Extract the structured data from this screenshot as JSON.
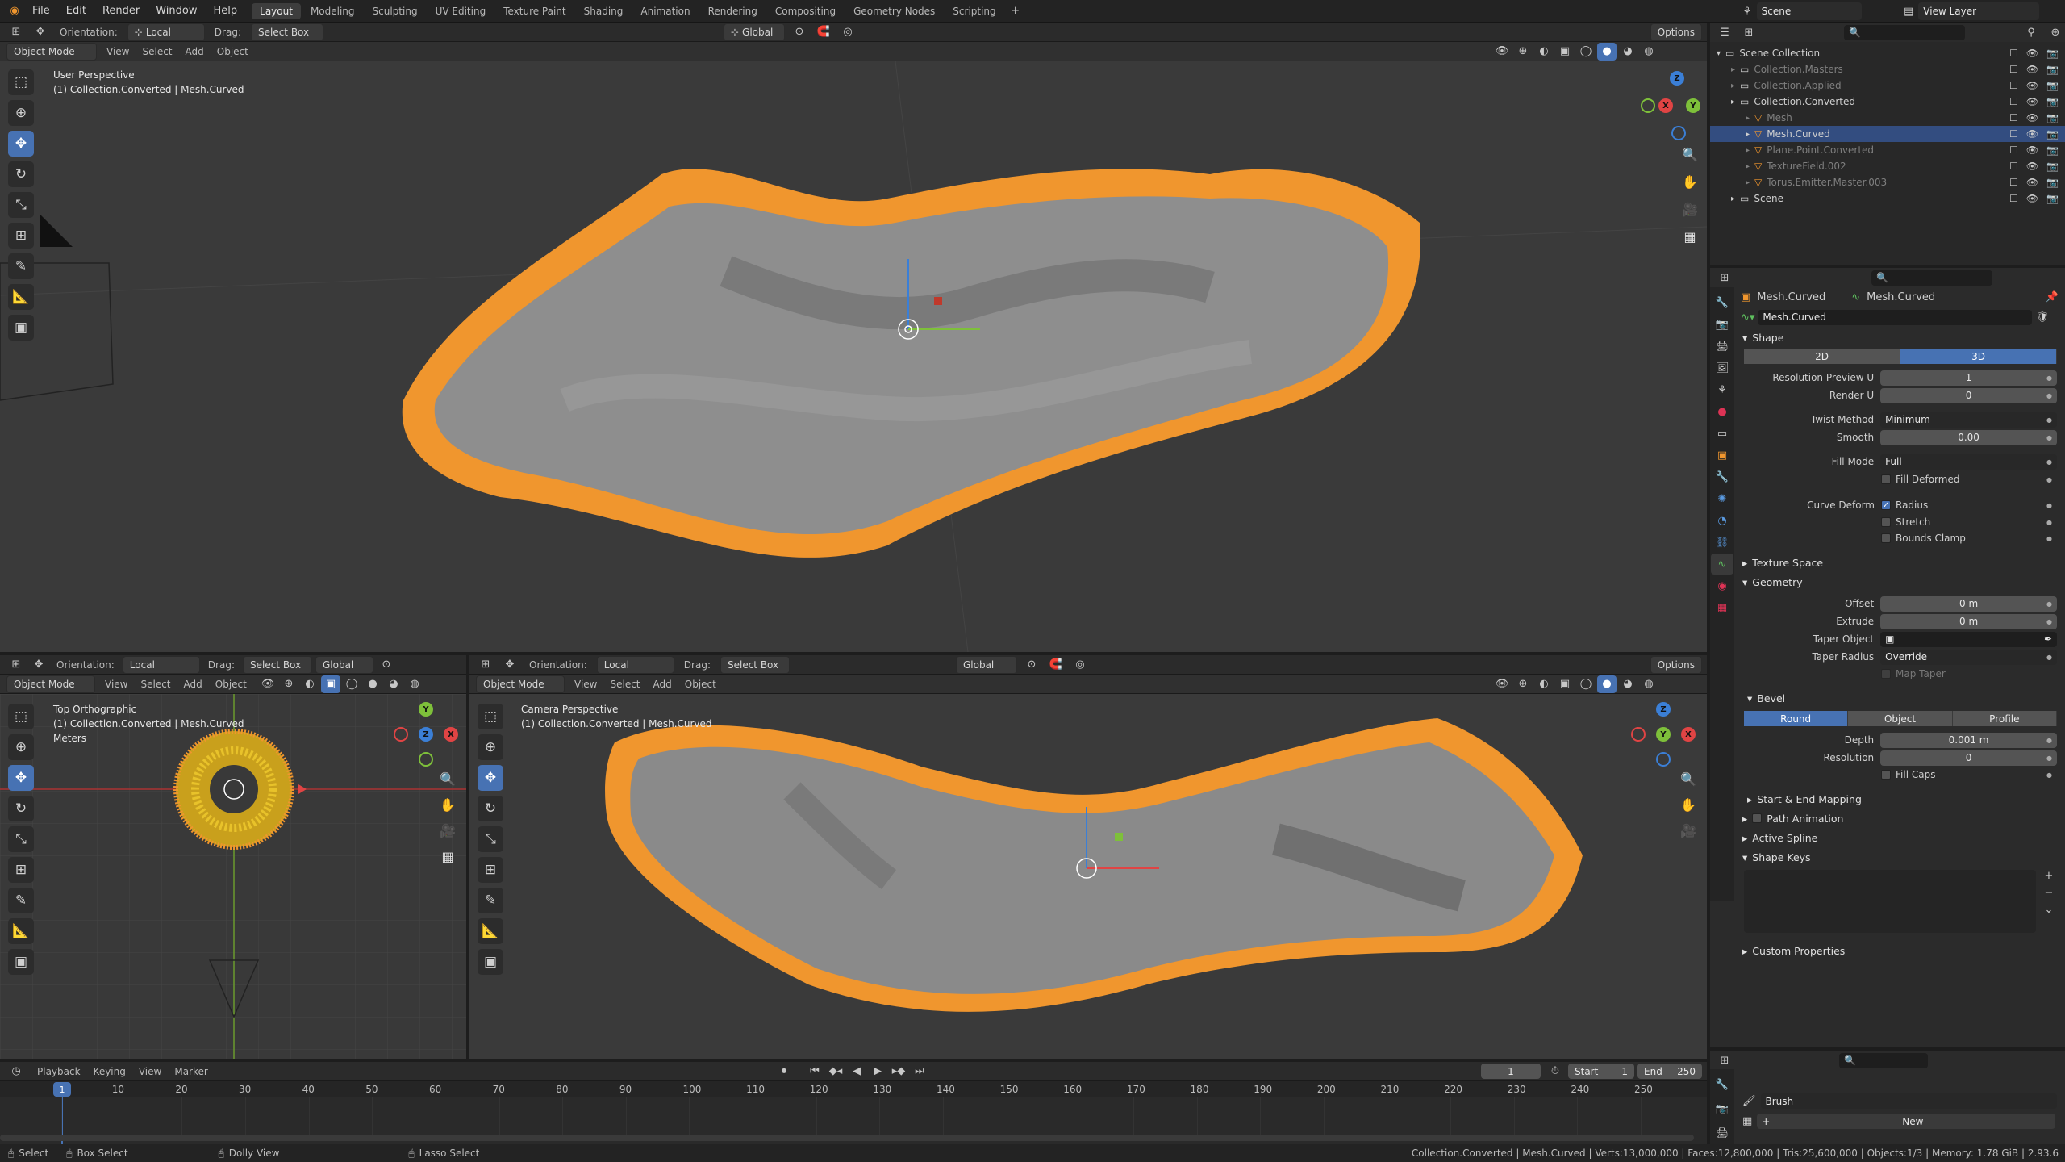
{
  "top_menu": {
    "items": [
      "File",
      "Edit",
      "Render",
      "Window",
      "Help"
    ],
    "workspaces": [
      "Layout",
      "Modeling",
      "Sculpting",
      "UV Editing",
      "Texture Paint",
      "Shading",
      "Animation",
      "Rendering",
      "Compositing",
      "Geometry Nodes",
      "Scripting"
    ],
    "active_workspace": "Layout",
    "add_tab": "+",
    "scene": "Scene",
    "view_layer": "View Layer"
  },
  "main_header": {
    "orientation_label": "Orientation:",
    "orientation_value": "Local",
    "drag_label": "Drag:",
    "drag_value": "Select Box",
    "transform_value": "Global",
    "options": "Options"
  },
  "main_viewport": {
    "mode": "Object Mode",
    "menus": [
      "View",
      "Select",
      "Add",
      "Object"
    ],
    "perspective": "User Perspective",
    "collection_info": "(1) Collection.Converted | Mesh.Curved"
  },
  "left_viewport": {
    "orientation_label": "Orientation:",
    "orientation_value": "Local",
    "drag_label": "Drag:",
    "drag_value": "Select Box",
    "transform_value": "Global",
    "mode": "Object Mode",
    "menus": [
      "View",
      "Select",
      "Add",
      "Object"
    ],
    "perspective": "Top Orthographic",
    "collection_info": "(1) Collection.Converted | Mesh.Curved",
    "units": "Meters"
  },
  "right_viewport": {
    "orientation_label": "Orientation:",
    "orientation_value": "Local",
    "drag_label": "Drag:",
    "drag_value": "Select Box",
    "transform_value": "Global",
    "options": "Options",
    "mode": "Object Mode",
    "menus": [
      "View",
      "Select",
      "Add",
      "Object"
    ],
    "perspective": "Camera Perspective",
    "collection_info": "(1) Collection.Converted | Mesh.Curved"
  },
  "outliner": {
    "rows": [
      {
        "label": "Scene Collection",
        "indent": 0,
        "state": "normal"
      },
      {
        "label": "Collection.Masters",
        "indent": 1,
        "state": "dim"
      },
      {
        "label": "Collection.Applied",
        "indent": 1,
        "state": "dim"
      },
      {
        "label": "Collection.Converted",
        "indent": 1,
        "state": "normal"
      },
      {
        "label": "Mesh",
        "indent": 2,
        "state": "dim"
      },
      {
        "label": "Mesh.Curved",
        "indent": 2,
        "state": "selected"
      },
      {
        "label": "Plane.Point.Converted",
        "indent": 2,
        "state": "dim"
      },
      {
        "label": "TextureField.002",
        "indent": 2,
        "state": "dim"
      },
      {
        "label": "Torus.Emitter.Master.003",
        "indent": 2,
        "state": "dim"
      },
      {
        "label": "Scene",
        "indent": 1,
        "state": "normal"
      }
    ]
  },
  "properties": {
    "object_name": "Mesh.Curved",
    "data_name": "Mesh.Curved",
    "datablock": "Mesh.Curved",
    "shape_header": "Shape",
    "dim_2d": "2D",
    "dim_3d": "3D",
    "resolution_preview_label": "Resolution Preview U",
    "resolution_preview_value": "1",
    "render_u_label": "Render U",
    "render_u_value": "0",
    "twist_label": "Twist Method",
    "twist_value": "Minimum",
    "smooth_label": "Smooth",
    "smooth_value": "0.00",
    "fill_label": "Fill Mode",
    "fill_value": "Full",
    "fill_deformed": "Fill Deformed",
    "curve_deform_label": "Curve Deform",
    "radius": "Radius",
    "stretch": "Stretch",
    "bounds_clamp": "Bounds Clamp",
    "texture_space": "Texture Space",
    "geometry": "Geometry",
    "offset_label": "Offset",
    "offset_value": "0 m",
    "extrude_label": "Extrude",
    "extrude_value": "0 m",
    "taper_object_label": "Taper Object",
    "taper_radius_label": "Taper Radius",
    "taper_radius_value": "Override",
    "map_taper": "Map Taper",
    "bevel": "Bevel",
    "bevel_round": "Round",
    "bevel_object": "Object",
    "bevel_profile": "Profile",
    "depth_label": "Depth",
    "depth_value": "0.001 m",
    "resolution_label": "Resolution",
    "resolution_value": "0",
    "fill_caps": "Fill Caps",
    "start_end_mapping": "Start & End Mapping",
    "path_animation": "Path Animation",
    "active_spline": "Active Spline",
    "shape_keys": "Shape Keys",
    "custom_properties": "Custom Properties"
  },
  "brush_panel": {
    "brush": "Brush",
    "new": "New"
  },
  "timeline": {
    "menus": [
      "Playback",
      "Keying",
      "View",
      "Marker"
    ],
    "current_frame": "1",
    "start_label": "Start",
    "start_value": "1",
    "end_label": "End",
    "end_value": "250",
    "ticks": [
      "1",
      "10",
      "20",
      "30",
      "40",
      "50",
      "60",
      "70",
      "80",
      "90",
      "100",
      "110",
      "120",
      "130",
      "140",
      "150",
      "160",
      "170",
      "180",
      "190",
      "200",
      "210",
      "220",
      "230",
      "240",
      "250"
    ]
  },
  "statusbar": {
    "select": "Select",
    "box_select": "Box Select",
    "dolly_view": "Dolly View",
    "lasso_select": "Lasso Select",
    "stats": "Collection.Converted | Mesh.Curved | Verts:13,000,000 | Faces:12,800,000 | Tris:25,600,000 | Objects:1/3 | Memory: 1.78 GiB | 2.93.6"
  },
  "colors": {
    "accent": "#4772b3",
    "hair_orange": "#f0962e",
    "hair_gray": "#8a8a8a",
    "viewport_bg": "#3a3a3a"
  }
}
